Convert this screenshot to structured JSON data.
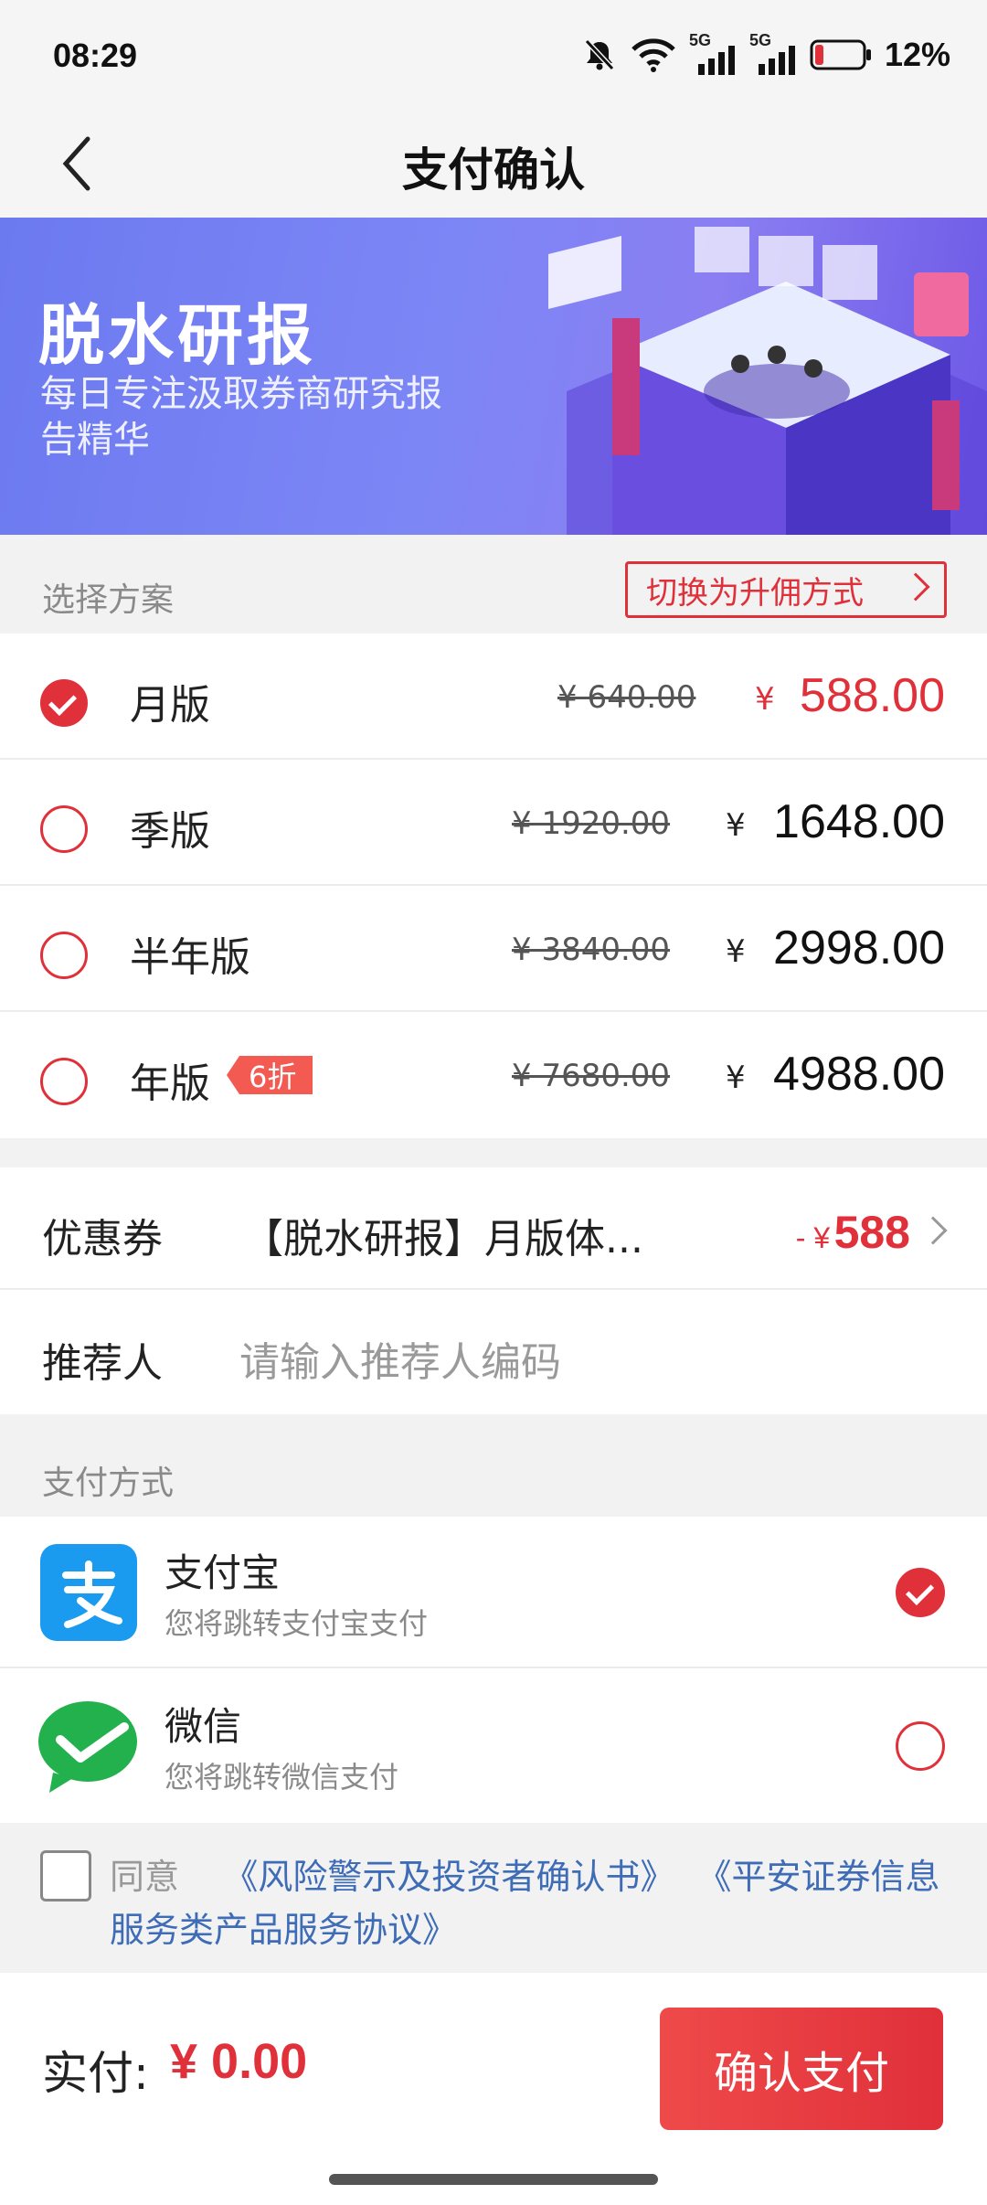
{
  "status_bar": {
    "time": "08:29",
    "battery": "12%",
    "signal_1": "5G",
    "signal_2": "5G"
  },
  "nav": {
    "title": "支付确认"
  },
  "banner": {
    "title": "脱水研报",
    "subtitle": "每日专注汲取券商研究报告精华"
  },
  "plans_section": {
    "label": "选择方案",
    "switch_label": "切换为升佣方式"
  },
  "plans": [
    {
      "name": "月版",
      "original": "¥ 640.00",
      "currency": "¥",
      "price": "588.00",
      "selected": true,
      "badge": ""
    },
    {
      "name": "季版",
      "original": "¥ 1920.00",
      "currency": "¥",
      "price": "1648.00",
      "selected": false,
      "badge": ""
    },
    {
      "name": "半年版",
      "original": "¥ 3840.00",
      "currency": "¥",
      "price": "2998.00",
      "selected": false,
      "badge": ""
    },
    {
      "name": "年版",
      "original": "¥ 7680.00",
      "currency": "¥",
      "price": "4988.00",
      "selected": false,
      "badge": "6折"
    }
  ],
  "coupon": {
    "label": "优惠券",
    "value": "【脱水研报】月版体...",
    "prefix": "- ¥",
    "amount": "588"
  },
  "referrer": {
    "label": "推荐人",
    "placeholder": "请输入推荐人编码"
  },
  "payment_section": {
    "label": "支付方式"
  },
  "payment_methods": [
    {
      "name": "支付宝",
      "desc": "您将跳转支付宝支付",
      "icon": "alipay-icon",
      "selected": true
    },
    {
      "name": "微信",
      "desc": "您将跳转微信支付",
      "icon": "wechat-icon",
      "selected": false
    }
  ],
  "agreement": {
    "prefix": "同意",
    "link1": "《风险警示及投资者确认书》",
    "link2": "《平安证券信息服务类产品服务协议》"
  },
  "footer": {
    "label": "实付:",
    "total": "¥ 0.00",
    "confirm": "确认支付"
  },
  "colors": {
    "accent": "#e0303a",
    "link": "#3f6cb6",
    "alipay": "#1a9bf0",
    "wechat": "#22b14c"
  }
}
